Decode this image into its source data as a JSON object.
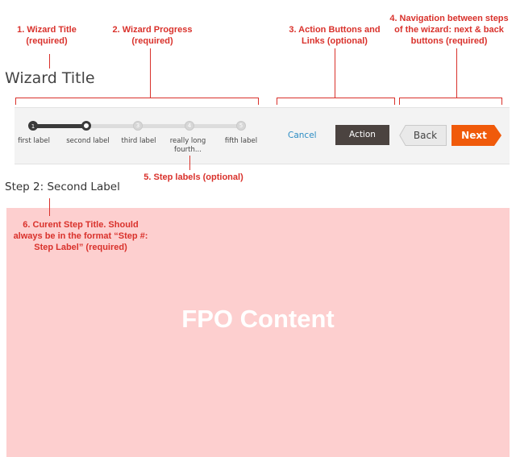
{
  "annotations": {
    "a1": "1. Wizard Title (required)",
    "a2": "2. Wizard Progress (required)",
    "a3": "3. Action Buttons and Links (optional)",
    "a4": "4. Navigation between steps of the wizard: next & back buttons (required)",
    "a5": "5. Step labels (optional)",
    "a6": "6. Curent Step Title. Should always be in the format “Step #: Step Label” (required)"
  },
  "wizard": {
    "title": "Wizard Title",
    "steps": [
      {
        "number": "1",
        "label": "first label",
        "status": "done"
      },
      {
        "number": "2",
        "label": "second label",
        "status": "current"
      },
      {
        "number": "3",
        "label": "third label",
        "status": "todo"
      },
      {
        "number": "4",
        "label": "really long fourth...",
        "status": "todo"
      },
      {
        "number": "5",
        "label": "fifth label",
        "status": "todo"
      }
    ],
    "cancel_label": "Cancel",
    "action_label": "Action",
    "back_label": "Back",
    "next_label": "Next",
    "current_step_title": "Step 2: Second Label"
  },
  "content": {
    "placeholder": "FPO Content"
  },
  "colors": {
    "annotation": "#d9312b",
    "progress_done": "#3a3a3a",
    "cancel_link": "#2b8cc4",
    "action_button": "#4b4340",
    "next_button": "#f05a0a",
    "content_bg": "#fdcfcf"
  }
}
